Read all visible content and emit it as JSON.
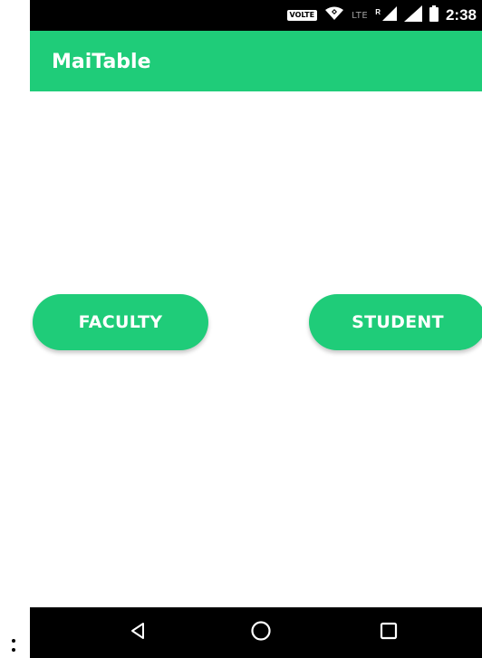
{
  "status_bar": {
    "volte_label": "VOLTE",
    "lte_label": "LTE",
    "roaming_label": "R",
    "time": "2:38"
  },
  "app_bar": {
    "title": "MaiTable",
    "color": "#1fcc79"
  },
  "main": {
    "faculty_button_label": "FACULTY",
    "student_button_label": "STUDENT"
  },
  "nav_bar": {
    "back_icon": "back-triangle-icon",
    "home_icon": "home-circle-icon",
    "recents_icon": "recents-square-icon"
  }
}
